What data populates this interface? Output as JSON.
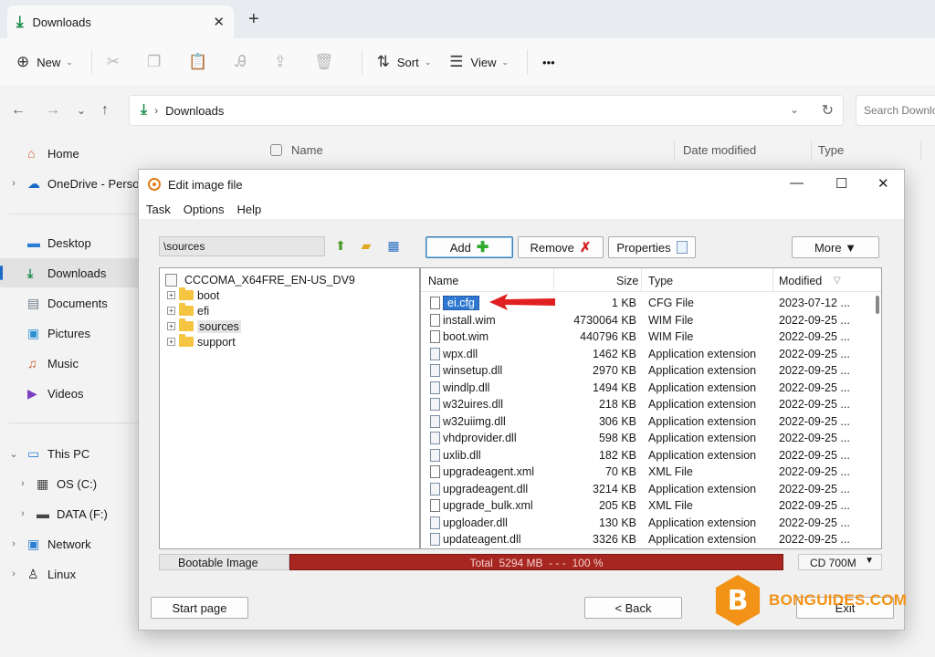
{
  "explorer": {
    "tab_title": "Downloads",
    "toolbar": {
      "new_label": "New",
      "sort_label": "Sort",
      "view_label": "View",
      "more_label": "•••"
    },
    "address": {
      "crumb": "Downloads",
      "search_placeholder": "Search Downloads"
    },
    "nav": [
      {
        "label": "Home",
        "icon": "home-icon"
      },
      {
        "label": "OneDrive - Personal",
        "icon": "cloud-icon"
      },
      {
        "label": "Desktop",
        "icon": "desktop-icon"
      },
      {
        "label": "Downloads",
        "icon": "download-icon"
      },
      {
        "label": "Documents",
        "icon": "document-icon"
      },
      {
        "label": "Pictures",
        "icon": "picture-icon"
      },
      {
        "label": "Music",
        "icon": "music-icon"
      },
      {
        "label": "Videos",
        "icon": "video-icon"
      },
      {
        "label": "This PC",
        "icon": "pc-icon"
      },
      {
        "label": "OS (C:)",
        "icon": "drive-icon"
      },
      {
        "label": "DATA (F:)",
        "icon": "drive-icon"
      },
      {
        "label": "Network",
        "icon": "network-icon"
      },
      {
        "label": "Linux",
        "icon": "linux-icon"
      }
    ],
    "columns": {
      "name": "Name",
      "date": "Date modified",
      "type": "Type"
    }
  },
  "dialog": {
    "title": "Edit image file",
    "menu": [
      "Task",
      "Options",
      "Help"
    ],
    "path": "\\sources",
    "buttons": {
      "add": "Add",
      "remove": "Remove",
      "properties": "Properties",
      "more": "More ▼"
    },
    "tree": {
      "root": "CCCOMA_X64FRE_EN-US_DV9",
      "folders": [
        "boot",
        "efi",
        "sources",
        "support"
      ]
    },
    "columns": {
      "name": "Name",
      "size": "Size",
      "type": "Type",
      "modified": "Modified"
    },
    "files": [
      {
        "name": "ei.cfg",
        "size": "1 KB",
        "type": "CFG File",
        "modified": "2023-07-12 ...",
        "kind": "doc"
      },
      {
        "name": "install.wim",
        "size": "4730064 KB",
        "type": "WIM File",
        "modified": "2022-09-25 ...",
        "kind": "doc"
      },
      {
        "name": "boot.wim",
        "size": "440796 KB",
        "type": "WIM File",
        "modified": "2022-09-25 ...",
        "kind": "doc"
      },
      {
        "name": "wpx.dll",
        "size": "1462 KB",
        "type": "Application extension",
        "modified": "2022-09-25 ...",
        "kind": "dll"
      },
      {
        "name": "winsetup.dll",
        "size": "2970 KB",
        "type": "Application extension",
        "modified": "2022-09-25 ...",
        "kind": "dll"
      },
      {
        "name": "windlp.dll",
        "size": "1494 KB",
        "type": "Application extension",
        "modified": "2022-09-25 ...",
        "kind": "dll"
      },
      {
        "name": "w32uires.dll",
        "size": "218 KB",
        "type": "Application extension",
        "modified": "2022-09-25 ...",
        "kind": "dll"
      },
      {
        "name": "w32uiimg.dll",
        "size": "306 KB",
        "type": "Application extension",
        "modified": "2022-09-25 ...",
        "kind": "dll"
      },
      {
        "name": "vhdprovider.dll",
        "size": "598 KB",
        "type": "Application extension",
        "modified": "2022-09-25 ...",
        "kind": "dll"
      },
      {
        "name": "uxlib.dll",
        "size": "182 KB",
        "type": "Application extension",
        "modified": "2022-09-25 ...",
        "kind": "dll"
      },
      {
        "name": "upgradeagent.xml",
        "size": "70 KB",
        "type": "XML File",
        "modified": "2022-09-25 ...",
        "kind": "doc"
      },
      {
        "name": "upgradeagent.dll",
        "size": "3214 KB",
        "type": "Application extension",
        "modified": "2022-09-25 ...",
        "kind": "dll"
      },
      {
        "name": "upgrade_bulk.xml",
        "size": "205 KB",
        "type": "XML File",
        "modified": "2022-09-25 ...",
        "kind": "doc"
      },
      {
        "name": "upgloader.dll",
        "size": "130 KB",
        "type": "Application extension",
        "modified": "2022-09-25 ...",
        "kind": "dll"
      },
      {
        "name": "updateagent.dll",
        "size": "3326 KB",
        "type": "Application extension",
        "modified": "2022-09-25 ...",
        "kind": "dll"
      }
    ],
    "status": {
      "left": "Bootable Image",
      "bar": "Total  5294 MB  - - -  100 %",
      "fill_percent": 100,
      "media": "CD 700M"
    },
    "footer": {
      "start": "Start page",
      "back": "< Back",
      "exit": "Exit"
    }
  },
  "watermark": "BONGUIDES.COM",
  "colors": {
    "accent": "#1b6ac9",
    "progress": "#a72620",
    "selection": "#2f78d2",
    "arrow": "#e02020",
    "logo": "#f29318"
  }
}
